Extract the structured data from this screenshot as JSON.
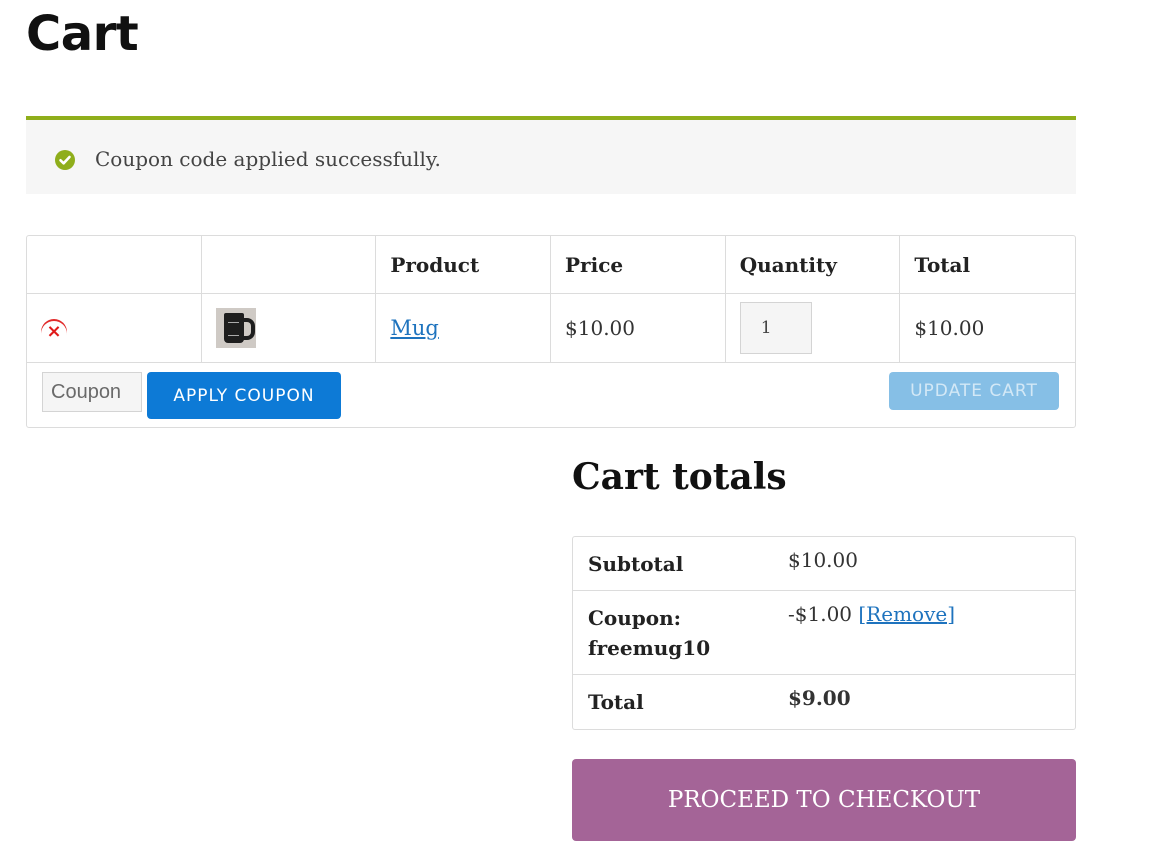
{
  "page": {
    "title": "Cart"
  },
  "notice": {
    "icon": "check-circle-icon",
    "message": "Coupon code applied successfully.",
    "accent_color": "#8fae1b"
  },
  "cart": {
    "headers": [
      "",
      "",
      "Product",
      "Price",
      "Quantity",
      "Total"
    ],
    "items": [
      {
        "remove_icon": "remove-x-icon",
        "thumbnail": "mug-image",
        "product": "Mug",
        "price": "$10.00",
        "quantity": "1",
        "total": "$10.00"
      }
    ],
    "coupon_placeholder": "Coupon",
    "apply_coupon_label": "APPLY COUPON",
    "update_cart_label": "UPDATE CART"
  },
  "totals": {
    "title": "Cart totals",
    "subtotal_label": "Subtotal",
    "subtotal_value": "$10.00",
    "coupon_label": "Coupon: freemug10",
    "coupon_value": "-$1.00",
    "coupon_remove": "[Remove]",
    "total_label": "Total",
    "total_value": "$9.00",
    "checkout_label": "PROCEED TO CHECKOUT"
  },
  "colors": {
    "primary_button": "#0d7ad6",
    "disabled_button": "#86bfe6",
    "checkout_button": "#a46497",
    "link": "#1e73be"
  }
}
